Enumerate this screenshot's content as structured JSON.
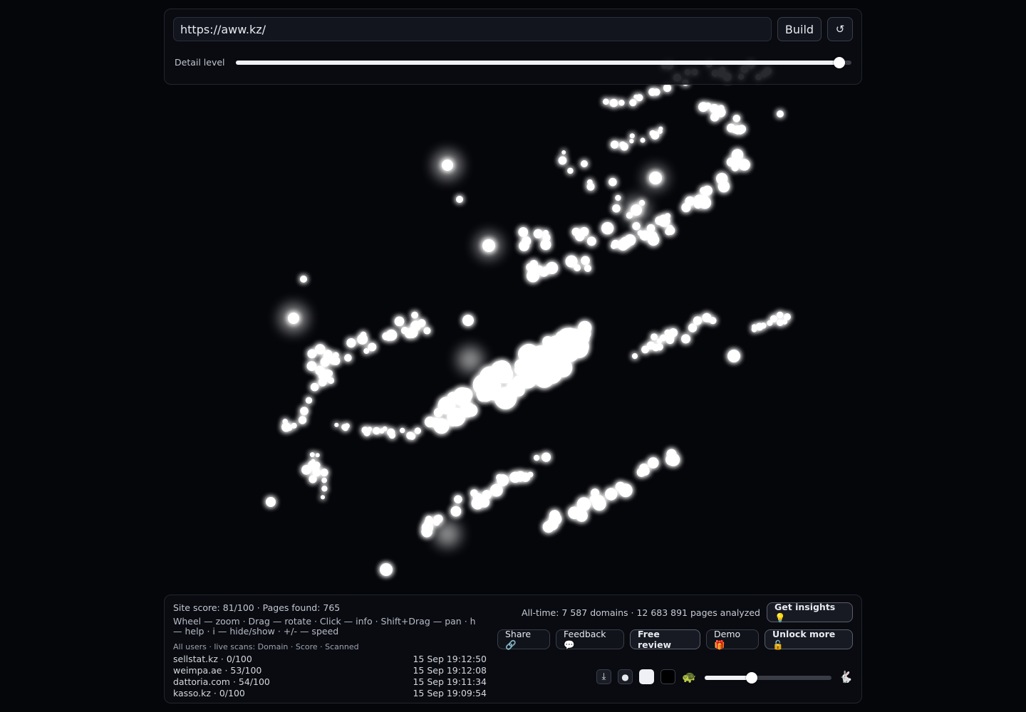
{
  "toolbar": {
    "url_value": "https://aww.kz/",
    "build_label": "Build",
    "reset_icon": "↺",
    "detail_label": "Detail level",
    "detail_level": 0.98
  },
  "footer": {
    "stats": "Site score: 81/100 · Pages found: 765",
    "help": "Wheel — zoom · Drag — rotate · Click — info · Shift+Drag — pan · h — help · i — hide/show · +/- — speed",
    "scans_header": "All users · live scans: Domain · Score · Scanned",
    "scans": [
      {
        "domain": "sellstat.kz · 0/100",
        "time": "15 Sep 19:12:50"
      },
      {
        "domain": "weimpa.ae · 53/100",
        "time": "15 Sep 19:12:08"
      },
      {
        "domain": "dattoria.com · 54/100",
        "time": "15 Sep 19:11:34"
      },
      {
        "domain": "kasso.kz · 0/100",
        "time": "15 Sep 19:09:54"
      }
    ],
    "alltime": "All-time: 7 587 domains · 12 683 891 pages analyzed",
    "buttons": {
      "insights": "Get insights 💡",
      "share": "Share 🔗",
      "feedback": "Feedback 💬",
      "review": "Free review",
      "demo": "Demo 🎁",
      "unlock": "Unlock more 🔓"
    },
    "controls": {
      "download_icon": "⤓",
      "dot_icon": "●",
      "turtle_icon": "🐢",
      "rabbit_icon": "🐇",
      "speed_level": 0.37
    }
  },
  "colors": {
    "background": "#05060a",
    "glow": "#ffffff",
    "panel": "#0a0c12"
  }
}
